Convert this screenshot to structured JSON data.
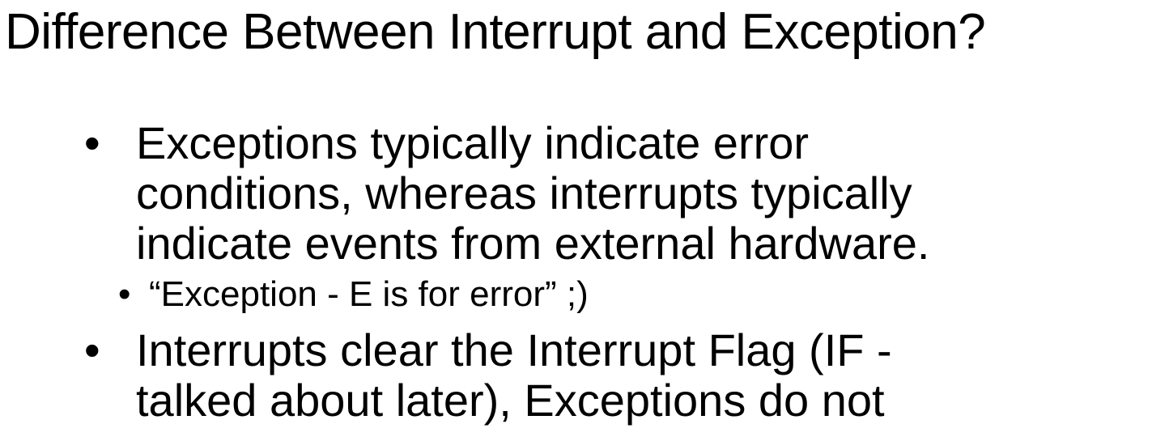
{
  "slide": {
    "title": "Difference Between Interrupt and Exception?",
    "bullets": [
      {
        "marker": "•",
        "lines": [
          "Exceptions typically indicate error",
          "conditions, whereas interrupts typically",
          "indicate events from external hardware."
        ],
        "sub_bullets": [
          {
            "marker": "•",
            "text": "“Exception - E is for error” ;)"
          }
        ]
      },
      {
        "marker": "•",
        "lines": [
          "Interrupts clear the Interrupt Flag (IF -",
          "talked about later), Exceptions do not"
        ]
      }
    ]
  }
}
